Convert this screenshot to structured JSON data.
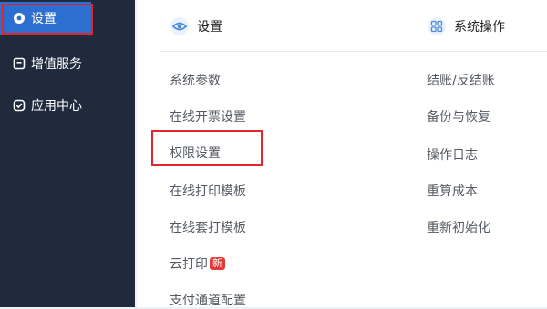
{
  "sidebar": {
    "items": [
      {
        "label": "设置",
        "icon": "eye-icon"
      },
      {
        "label": "增值服务",
        "icon": "square-icon"
      },
      {
        "label": "应用中心",
        "icon": "check-shield-icon"
      }
    ]
  },
  "panel": {
    "left_header": {
      "label": "设置",
      "icon": "eye-icon"
    },
    "right_header": {
      "label": "系统操作",
      "icon": "grid-icon"
    },
    "left_links": [
      "系统参数",
      "在线开票设置",
      "权限设置",
      "在线打印模板",
      "在线套打模板",
      "云打印",
      "支付通道配置"
    ],
    "new_badge": "新",
    "right_links": [
      "结账/反结账",
      "备份与恢复",
      "操作日志",
      "重算成本",
      "重新初始化"
    ]
  },
  "colors": {
    "sidebar": "#1f2b3d",
    "active": "#2d6fd0",
    "highlight": "#e0262a",
    "accent_icon": "#4a8bd8"
  }
}
